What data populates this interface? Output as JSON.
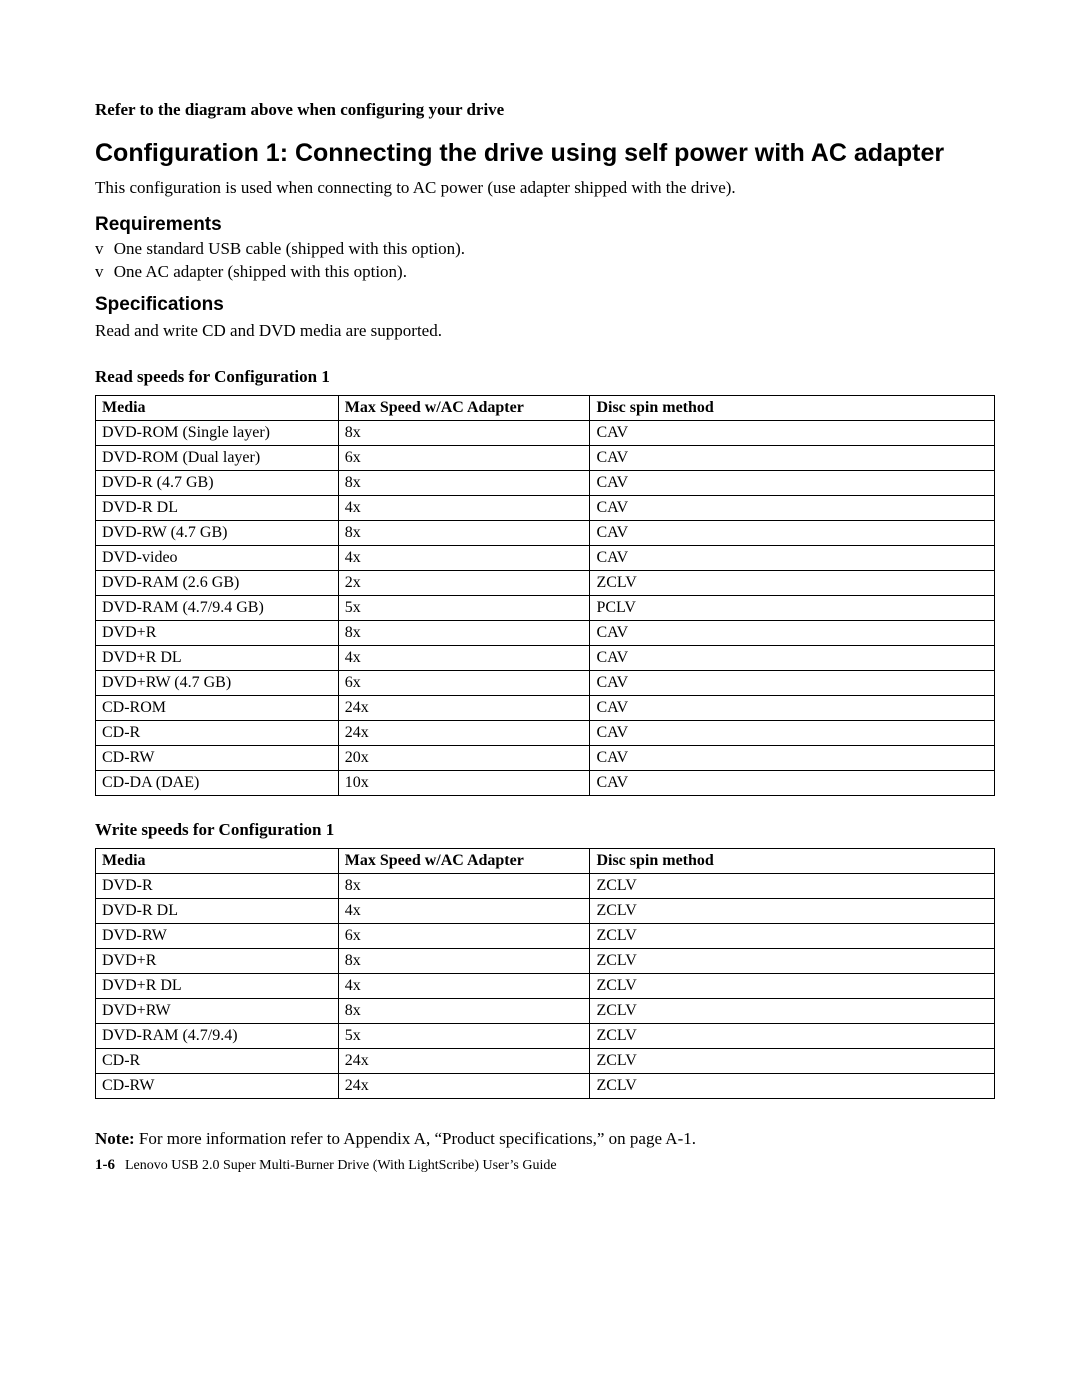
{
  "intro_bold": "Refer to the diagram above when configuring your drive",
  "heading": "Configuration 1: Connecting the drive using self power with AC adapter",
  "intro_para": "This configuration is used when connecting to AC power (use adapter shipped with the drive).",
  "requirements": {
    "heading": "Requirements",
    "items": [
      "One standard USB cable (shipped with this option).",
      "One AC adapter (shipped with this option)."
    ]
  },
  "specifications": {
    "heading": "Specifications",
    "intro": "Read and write CD and DVD media are supported."
  },
  "read_table": {
    "title": "Read speeds for Configuration 1",
    "headers": {
      "media": "Media",
      "speed": "Max Speed w/AC Adapter",
      "method": "Disc spin method"
    },
    "rows": [
      {
        "media": "DVD-ROM (Single layer)",
        "speed": "8x",
        "method": "CAV"
      },
      {
        "media": "DVD-ROM (Dual layer)",
        "speed": "6x",
        "method": "CAV"
      },
      {
        "media": "DVD-R (4.7 GB)",
        "speed": "8x",
        "method": "CAV"
      },
      {
        "media": "DVD-R DL",
        "speed": "4x",
        "method": "CAV"
      },
      {
        "media": "DVD-RW (4.7 GB)",
        "speed": "8x",
        "method": "CAV"
      },
      {
        "media": "DVD-video",
        "speed": "4x",
        "method": "CAV"
      },
      {
        "media": "DVD-RAM (2.6 GB)",
        "speed": "2x",
        "method": "ZCLV"
      },
      {
        "media": "DVD-RAM (4.7/9.4 GB)",
        "speed": "5x",
        "method": "PCLV"
      },
      {
        "media": "DVD+R",
        "speed": "8x",
        "method": "CAV"
      },
      {
        "media": "DVD+R DL",
        "speed": "4x",
        "method": "CAV"
      },
      {
        "media": "DVD+RW (4.7 GB)",
        "speed": "6x",
        "method": "CAV"
      },
      {
        "media": "CD-ROM",
        "speed": "24x",
        "method": "CAV"
      },
      {
        "media": "CD-R",
        "speed": "24x",
        "method": "CAV"
      },
      {
        "media": "CD-RW",
        "speed": "20x",
        "method": "CAV"
      },
      {
        "media": "CD-DA (DAE)",
        "speed": "10x",
        "method": "CAV"
      }
    ]
  },
  "write_table": {
    "title": "Write speeds for Configuration 1",
    "headers": {
      "media": "Media",
      "speed": "Max Speed w/AC Adapter",
      "method": "Disc spin method"
    },
    "rows": [
      {
        "media": "DVD-R",
        "speed": "8x",
        "method": "ZCLV"
      },
      {
        "media": "DVD-R DL",
        "speed": "4x",
        "method": "ZCLV"
      },
      {
        "media": "DVD-RW",
        "speed": "6x",
        "method": "ZCLV"
      },
      {
        "media": "DVD+R",
        "speed": "8x",
        "method": "ZCLV"
      },
      {
        "media": "DVD+R DL",
        "speed": "4x",
        "method": "ZCLV"
      },
      {
        "media": "DVD+RW",
        "speed": "8x",
        "method": "ZCLV"
      },
      {
        "media": "DVD-RAM (4.7/9.4)",
        "speed": "5x",
        "method": "ZCLV"
      },
      {
        "media": "CD-R",
        "speed": "24x",
        "method": "ZCLV"
      },
      {
        "media": "CD-RW",
        "speed": "24x",
        "method": "ZCLV"
      }
    ]
  },
  "note": {
    "label": "Note:",
    "text": " For more information refer to Appendix A, “Product specifications,” on page A-1."
  },
  "footer": {
    "page": "1-6",
    "title": "Lenovo USB 2.0 Super Multi-Burner Drive (With LightScribe) User’s Guide"
  }
}
